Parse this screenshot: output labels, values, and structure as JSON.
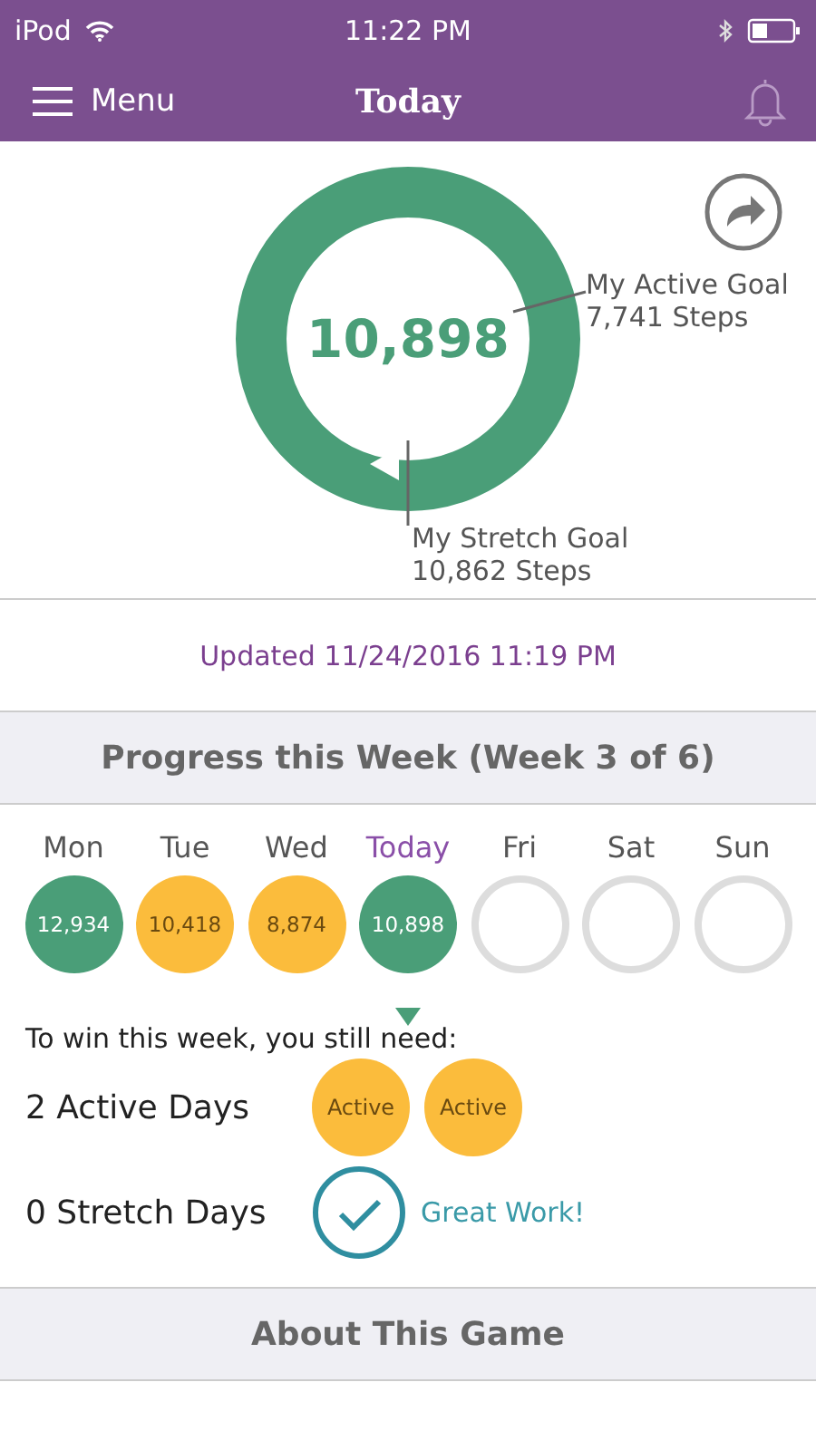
{
  "status_bar": {
    "carrier": "iPod",
    "time": "11:22 PM"
  },
  "nav": {
    "menu": "Menu",
    "title": "Today"
  },
  "summary": {
    "steps": "10,898",
    "active_goal": {
      "label": "My Active Goal",
      "value": "7,741 Steps"
    },
    "stretch_goal": {
      "label": "My Stretch Goal",
      "value": "10,862 Steps"
    }
  },
  "updated": "Updated 11/24/2016 11:19 PM",
  "week": {
    "title": "Progress this Week (Week 3 of 6)",
    "days": [
      {
        "label": "Mon",
        "steps": "12,934",
        "kind": "filled",
        "color": "#4a9e78",
        "selected": false
      },
      {
        "label": "Tue",
        "steps": "10,418",
        "kind": "filled",
        "color": "#fbbc3c",
        "selected": false
      },
      {
        "label": "Wed",
        "steps": "8,874",
        "kind": "filled",
        "color": "#fbbc3c",
        "selected": false
      },
      {
        "label": "Today",
        "steps": "10,898",
        "kind": "filled",
        "color": "#4a9e78",
        "selected": true
      },
      {
        "label": "Fri",
        "kind": "empty",
        "selected": false
      },
      {
        "label": "Sat",
        "kind": "empty",
        "selected": false
      },
      {
        "label": "Sun",
        "kind": "empty",
        "selected": false
      }
    ]
  },
  "need": {
    "intro": "To win this week, you still need:",
    "rows": [
      {
        "label": "2 Active Days",
        "kind": "badges",
        "badges": [
          "Active",
          "Active"
        ]
      },
      {
        "label": "0 Stretch Days",
        "kind": "done",
        "message": "Great Work!"
      }
    ]
  },
  "about": "About This Game"
}
